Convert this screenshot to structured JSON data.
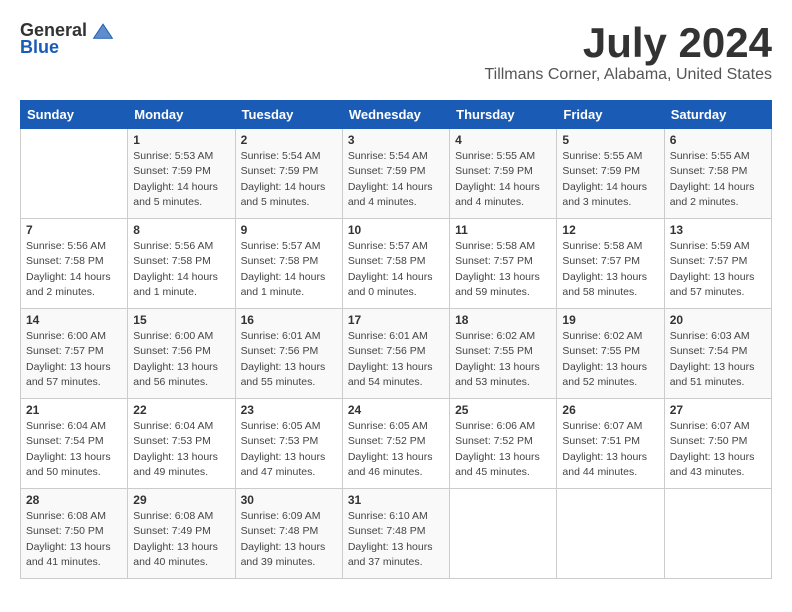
{
  "logo": {
    "general": "General",
    "blue": "Blue"
  },
  "title": "July 2024",
  "location": "Tillmans Corner, Alabama, United States",
  "headers": [
    "Sunday",
    "Monday",
    "Tuesday",
    "Wednesday",
    "Thursday",
    "Friday",
    "Saturday"
  ],
  "weeks": [
    [
      {
        "day": "",
        "info": ""
      },
      {
        "day": "1",
        "info": "Sunrise: 5:53 AM\nSunset: 7:59 PM\nDaylight: 14 hours\nand 5 minutes."
      },
      {
        "day": "2",
        "info": "Sunrise: 5:54 AM\nSunset: 7:59 PM\nDaylight: 14 hours\nand 5 minutes."
      },
      {
        "day": "3",
        "info": "Sunrise: 5:54 AM\nSunset: 7:59 PM\nDaylight: 14 hours\nand 4 minutes."
      },
      {
        "day": "4",
        "info": "Sunrise: 5:55 AM\nSunset: 7:59 PM\nDaylight: 14 hours\nand 4 minutes."
      },
      {
        "day": "5",
        "info": "Sunrise: 5:55 AM\nSunset: 7:59 PM\nDaylight: 14 hours\nand 3 minutes."
      },
      {
        "day": "6",
        "info": "Sunrise: 5:55 AM\nSunset: 7:58 PM\nDaylight: 14 hours\nand 2 minutes."
      }
    ],
    [
      {
        "day": "7",
        "info": "Sunrise: 5:56 AM\nSunset: 7:58 PM\nDaylight: 14 hours\nand 2 minutes."
      },
      {
        "day": "8",
        "info": "Sunrise: 5:56 AM\nSunset: 7:58 PM\nDaylight: 14 hours\nand 1 minute."
      },
      {
        "day": "9",
        "info": "Sunrise: 5:57 AM\nSunset: 7:58 PM\nDaylight: 14 hours\nand 1 minute."
      },
      {
        "day": "10",
        "info": "Sunrise: 5:57 AM\nSunset: 7:58 PM\nDaylight: 14 hours\nand 0 minutes."
      },
      {
        "day": "11",
        "info": "Sunrise: 5:58 AM\nSunset: 7:57 PM\nDaylight: 13 hours\nand 59 minutes."
      },
      {
        "day": "12",
        "info": "Sunrise: 5:58 AM\nSunset: 7:57 PM\nDaylight: 13 hours\nand 58 minutes."
      },
      {
        "day": "13",
        "info": "Sunrise: 5:59 AM\nSunset: 7:57 PM\nDaylight: 13 hours\nand 57 minutes."
      }
    ],
    [
      {
        "day": "14",
        "info": "Sunrise: 6:00 AM\nSunset: 7:57 PM\nDaylight: 13 hours\nand 57 minutes."
      },
      {
        "day": "15",
        "info": "Sunrise: 6:00 AM\nSunset: 7:56 PM\nDaylight: 13 hours\nand 56 minutes."
      },
      {
        "day": "16",
        "info": "Sunrise: 6:01 AM\nSunset: 7:56 PM\nDaylight: 13 hours\nand 55 minutes."
      },
      {
        "day": "17",
        "info": "Sunrise: 6:01 AM\nSunset: 7:56 PM\nDaylight: 13 hours\nand 54 minutes."
      },
      {
        "day": "18",
        "info": "Sunrise: 6:02 AM\nSunset: 7:55 PM\nDaylight: 13 hours\nand 53 minutes."
      },
      {
        "day": "19",
        "info": "Sunrise: 6:02 AM\nSunset: 7:55 PM\nDaylight: 13 hours\nand 52 minutes."
      },
      {
        "day": "20",
        "info": "Sunrise: 6:03 AM\nSunset: 7:54 PM\nDaylight: 13 hours\nand 51 minutes."
      }
    ],
    [
      {
        "day": "21",
        "info": "Sunrise: 6:04 AM\nSunset: 7:54 PM\nDaylight: 13 hours\nand 50 minutes."
      },
      {
        "day": "22",
        "info": "Sunrise: 6:04 AM\nSunset: 7:53 PM\nDaylight: 13 hours\nand 49 minutes."
      },
      {
        "day": "23",
        "info": "Sunrise: 6:05 AM\nSunset: 7:53 PM\nDaylight: 13 hours\nand 47 minutes."
      },
      {
        "day": "24",
        "info": "Sunrise: 6:05 AM\nSunset: 7:52 PM\nDaylight: 13 hours\nand 46 minutes."
      },
      {
        "day": "25",
        "info": "Sunrise: 6:06 AM\nSunset: 7:52 PM\nDaylight: 13 hours\nand 45 minutes."
      },
      {
        "day": "26",
        "info": "Sunrise: 6:07 AM\nSunset: 7:51 PM\nDaylight: 13 hours\nand 44 minutes."
      },
      {
        "day": "27",
        "info": "Sunrise: 6:07 AM\nSunset: 7:50 PM\nDaylight: 13 hours\nand 43 minutes."
      }
    ],
    [
      {
        "day": "28",
        "info": "Sunrise: 6:08 AM\nSunset: 7:50 PM\nDaylight: 13 hours\nand 41 minutes."
      },
      {
        "day": "29",
        "info": "Sunrise: 6:08 AM\nSunset: 7:49 PM\nDaylight: 13 hours\nand 40 minutes."
      },
      {
        "day": "30",
        "info": "Sunrise: 6:09 AM\nSunset: 7:48 PM\nDaylight: 13 hours\nand 39 minutes."
      },
      {
        "day": "31",
        "info": "Sunrise: 6:10 AM\nSunset: 7:48 PM\nDaylight: 13 hours\nand 37 minutes."
      },
      {
        "day": "",
        "info": ""
      },
      {
        "day": "",
        "info": ""
      },
      {
        "day": "",
        "info": ""
      }
    ]
  ]
}
